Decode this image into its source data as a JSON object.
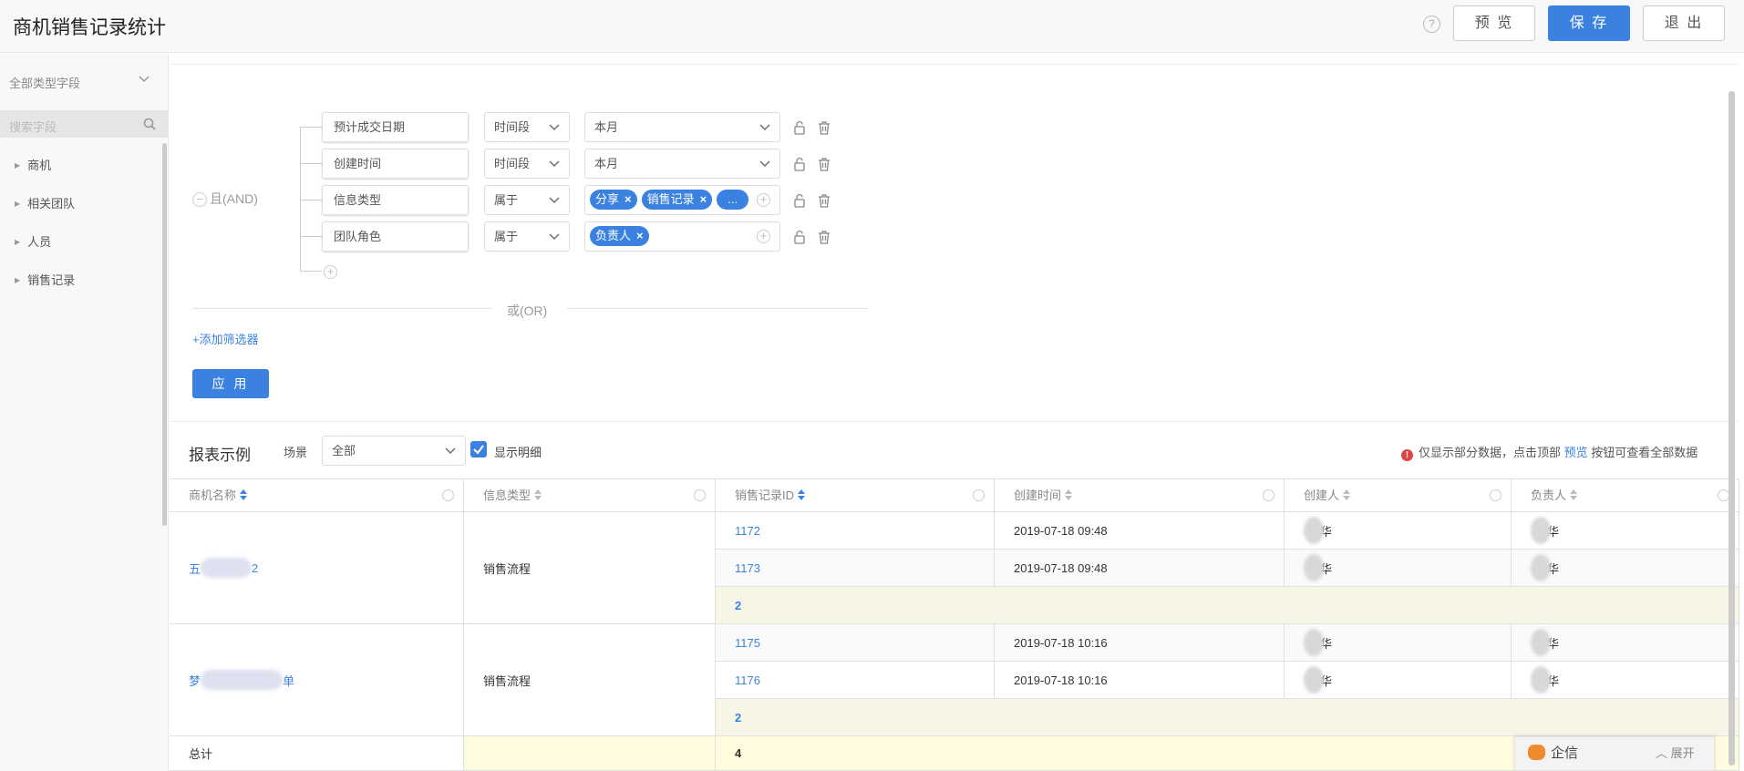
{
  "header": {
    "title": "商机销售记录统计",
    "help": "?",
    "preview": "预 览",
    "save": "保 存",
    "exit": "退 出"
  },
  "sidebar": {
    "field_filter": "全部类型字段",
    "search_placeholder": "搜索字段",
    "items": [
      "商机",
      "相关团队",
      "人员",
      "销售记录"
    ]
  },
  "filter": {
    "and_label": "且(AND)",
    "or_label": "或(OR)",
    "rows": [
      {
        "field": "预计成交日期",
        "op": "时间段",
        "value": "本月"
      },
      {
        "field": "创建时间",
        "op": "时间段",
        "value": "本月"
      },
      {
        "field": "信息类型",
        "op": "属于",
        "tags": [
          "分享",
          "销售记录",
          "..."
        ]
      },
      {
        "field": "团队角色",
        "op": "属于",
        "tags": [
          "负责人"
        ]
      }
    ],
    "add_filter": "+添加筛选器",
    "apply": "应 用"
  },
  "report": {
    "title": "报表示例",
    "scene_label": "场景",
    "scene_value": "全部",
    "show_detail": "显示明细",
    "notice_pre": "仅显示部分数据，点击顶部",
    "notice_link": "预览",
    "notice_post": "按钮可查看全部数据",
    "columns": [
      "商机名称",
      "信息类型",
      "销售记录ID",
      "创建时间",
      "创建人",
      "负责人"
    ],
    "groups": [
      {
        "name_start": "五",
        "name_end": "2",
        "type": "销售流程",
        "rows": [
          {
            "id": "1172",
            "time": "2019-07-18 09:48",
            "creator": "华",
            "owner": "华"
          },
          {
            "id": "1173",
            "time": "2019-07-18 09:48",
            "creator": "华",
            "owner": "华"
          }
        ],
        "subtotal": "2"
      },
      {
        "name_start": "梦",
        "name_end": "单",
        "type": "销售流程",
        "rows": [
          {
            "id": "1175",
            "time": "2019-07-18 10:16",
            "creator": "华",
            "owner": "华"
          },
          {
            "id": "1176",
            "time": "2019-07-18 10:16",
            "creator": "华",
            "owner": "华"
          }
        ],
        "subtotal": "2"
      }
    ],
    "total_label": "总计",
    "total_value": "4"
  },
  "qixin": {
    "label": "企信",
    "expand": "展开"
  },
  "colors": {
    "accent": "#3b82e0",
    "subtotal_bg": "#f7f6e6",
    "total_bg": "#fffbdf"
  }
}
